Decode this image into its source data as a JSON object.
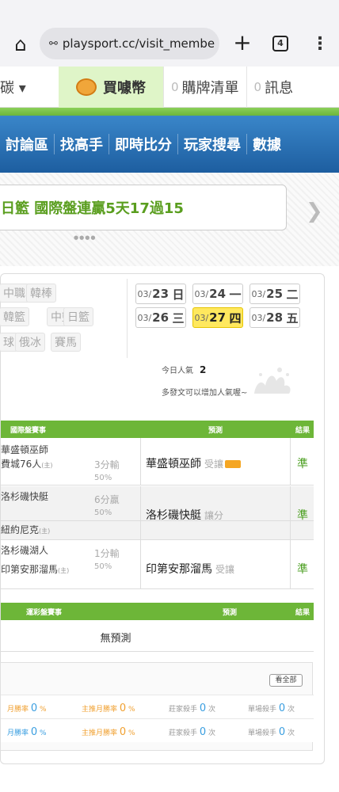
{
  "browser": {
    "url": "playsport.cc/visit_membe",
    "tabs_count": "4"
  },
  "user_bar": {
    "left_label": "碳 ▾",
    "coin_label": "買噱幣",
    "cart_count": "0",
    "cart_label": "購牌清單",
    "msg_count": "0",
    "msg_label": "訊息"
  },
  "nav": [
    "討論區",
    "找高手",
    "即時比分",
    "玩家搜尋",
    "數據"
  ],
  "banner": {
    "text": "日籃 國際盤連贏5天17過15",
    "dots": "●●●●"
  },
  "sports": {
    "row1": [
      "中職",
      "韓棒"
    ],
    "row2": [
      "韓籃",
      "中籃",
      "日籃"
    ],
    "row3": [
      "球",
      "俄冰",
      "賽馬"
    ]
  },
  "dates": [
    {
      "md": "03/",
      "d": "23",
      "w": "日",
      "active": false
    },
    {
      "md": "03/",
      "d": "24",
      "w": "一",
      "active": false
    },
    {
      "md": "03/",
      "d": "25",
      "w": "二",
      "active": false
    },
    {
      "md": "03/",
      "d": "26",
      "w": "三",
      "active": false
    },
    {
      "md": "03/",
      "d": "27",
      "w": "四",
      "active": true
    },
    {
      "md": "03/",
      "d": "28",
      "w": "五",
      "active": false
    }
  ],
  "popularity": {
    "label": "今日人氣",
    "value": "2",
    "hint": "多發文可以增加人氣喔~"
  },
  "intl_table": {
    "headers": {
      "match": "國際盤賽事",
      "predict": "預測",
      "result": "結果"
    },
    "rows": [
      {
        "team1": "華盛頓巫師",
        "team2": "費城76人",
        "host": "(主)",
        "h1": "3分輸",
        "h2": "50%",
        "pick": "華盛頓巫師",
        "pick_note": "受讓",
        "badge": true,
        "result": "準"
      },
      {
        "team1": "洛杉磯快艇",
        "team2": "紐約尼克",
        "host": "(主)",
        "h1": "6分贏",
        "h2": "50%",
        "pick": "洛杉磯快艇",
        "pick_note": "讓分",
        "badge": false,
        "result": "準"
      },
      {
        "team1": "洛杉磯湖人",
        "team2": "印第安那溜馬",
        "host": "(主)",
        "h1": "1分輸",
        "h2": "50%",
        "pick": "印第安那溜馬",
        "pick_note": "受讓",
        "badge": false,
        "result": "準"
      }
    ]
  },
  "lottery_table": {
    "headers": {
      "match": "運彩盤賽事",
      "predict": "預測",
      "result": "結果"
    },
    "empty_text": "無預測"
  },
  "stats": {
    "see_all": "看全部",
    "rows": [
      [
        {
          "label": "月勝率",
          "value": "0",
          "unit": "%",
          "color": "#3a9ee0"
        },
        {
          "label": "主推月勝率",
          "value": "0",
          "unit": "%",
          "color": "#f0a030"
        },
        {
          "label": "莊家殺手",
          "value": "0",
          "unit": "次",
          "color": "#999"
        },
        {
          "label": "單場殺手",
          "value": "0",
          "unit": "次",
          "color": "#999"
        }
      ],
      [
        {
          "label": "月勝率",
          "value": "0",
          "unit": "%",
          "color": "#3a9ee0"
        },
        {
          "label": "主推月勝率",
          "value": "0",
          "unit": "%",
          "color": "#f0a030"
        },
        {
          "label": "莊家殺手",
          "value": "0",
          "unit": "次",
          "color": "#999"
        },
        {
          "label": "單場殺手",
          "value": "0",
          "unit": "次",
          "color": "#999"
        }
      ]
    ]
  },
  "colors": {
    "accent_green": "#6db638",
    "nav_blue": "#1d5ea0",
    "win_green": "#4a9e1f",
    "active_date": "#ffe85e"
  }
}
